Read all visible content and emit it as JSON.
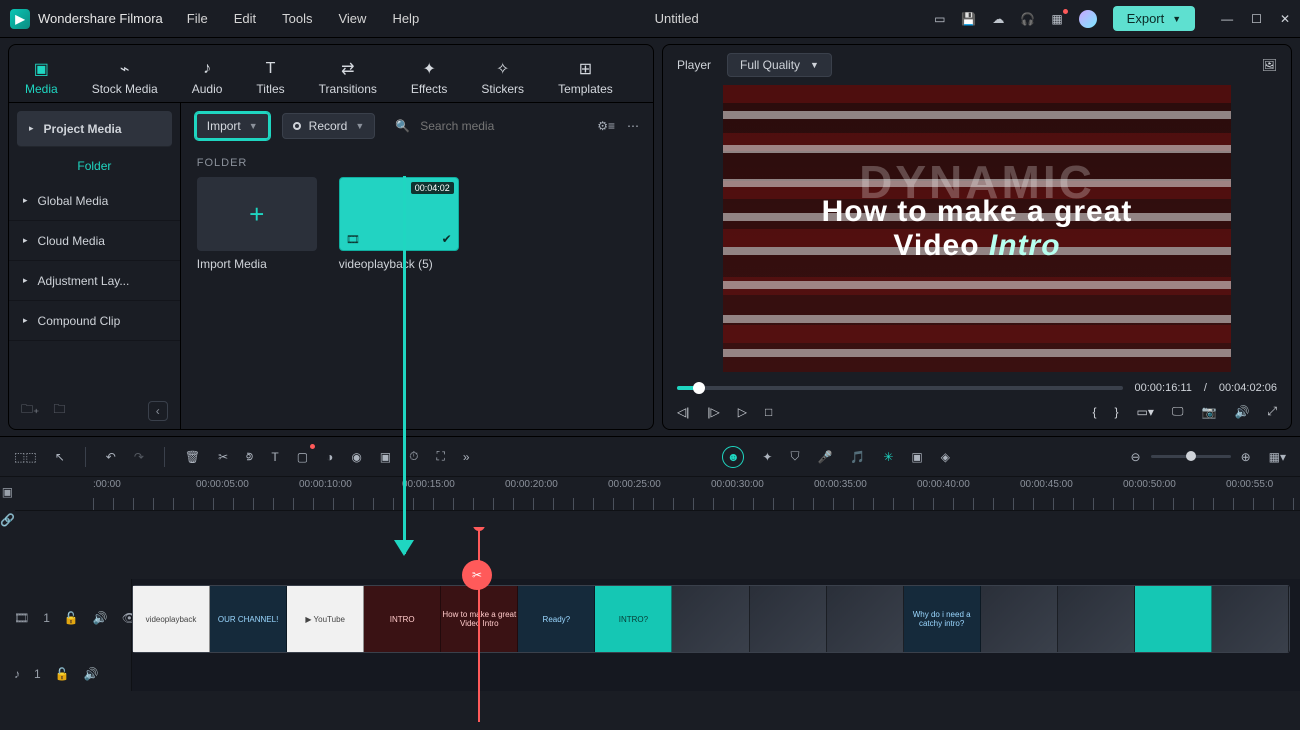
{
  "app": {
    "name": "Wondershare Filmora",
    "doc": "Untitled",
    "export": "Export"
  },
  "menu": {
    "file": "File",
    "edit": "Edit",
    "tools": "Tools",
    "view": "View",
    "help": "Help"
  },
  "tabs": {
    "media": "Media",
    "stock": "Stock Media",
    "audio": "Audio",
    "titles": "Titles",
    "transitions": "Transitions",
    "effects": "Effects",
    "stickers": "Stickers",
    "templates": "Templates"
  },
  "sidebar": {
    "project": "Project Media",
    "folder": "Folder",
    "global": "Global Media",
    "cloud": "Cloud Media",
    "adjust": "Adjustment Lay...",
    "compound": "Compound Clip"
  },
  "toolbar": {
    "import": "Import",
    "record": "Record",
    "search_ph": "Search media",
    "folder": "FOLDER"
  },
  "cards": {
    "import": "Import Media",
    "file": "videoplayback (5)",
    "dur": "00:04:02"
  },
  "player": {
    "label": "Player",
    "quality": "Full Quality",
    "bigline": "How to make a great",
    "intro": "Video Intro",
    "dyn": "DYNAMIC",
    "cur": "00:00:16:11",
    "sep": "/",
    "total": "00:04:02:06"
  },
  "ruler": {
    "t0": ":00:00",
    "t1": "00:00:05:00",
    "t2": "00:00:10:00",
    "t3": "00:00:15:00",
    "t4": "00:00:20:00",
    "t5": "00:00:25:00",
    "t6": "00:00:30:00",
    "t7": "00:00:35:00",
    "t8": "00:00:40:00",
    "t9": "00:00:45:00",
    "t10": "00:00:50:00",
    "t11": "00:00:55:0"
  },
  "frames": {
    "f0": "videoplayback",
    "f1": "OUR CHANNEL!",
    "f2": "▶ YouTube",
    "f3": "INTRO",
    "f4": "How to make a great Video Intro",
    "f5": "Ready?",
    "f6": "INTRO?",
    "f7": "",
    "f8": "",
    "f9": "",
    "f10": "Why do i need a catchy intro?",
    "f11": "",
    "f12": "",
    "f13": "",
    "f14": ""
  },
  "track": {
    "v1": "1",
    "a1": "1"
  }
}
